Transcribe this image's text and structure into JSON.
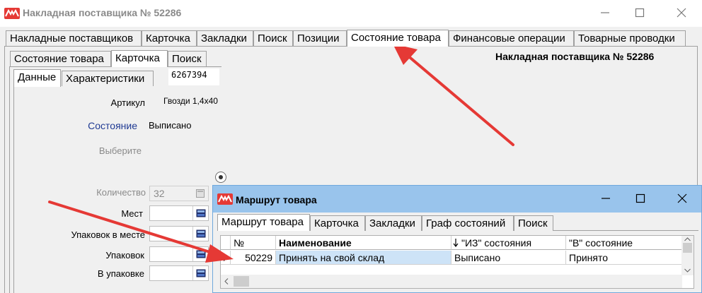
{
  "main_window": {
    "title": "Накладная поставщика № 52286",
    "tabs": [
      "Накладные поставщиков",
      "Карточка",
      "Закладки",
      "Поиск",
      "Позиции",
      "Состояние товара",
      "Финансовые операции",
      "Товарные проводки"
    ],
    "active_tab_index": 5,
    "sub_tabs": [
      "Состояние товара",
      "Карточка",
      "Поиск"
    ],
    "active_sub_tab_index": 1,
    "card_tabs": [
      "Данные",
      "Характеристики"
    ],
    "active_card_tab_index": 0,
    "doc_header": "Накладная поставщика № 52286",
    "code": "6267394",
    "fields": {
      "article_label": "Артикул",
      "article_value": "Гвозди 1,4х40",
      "state_label": "Состояние",
      "state_value": "Выписано",
      "choose_label": "Выберите",
      "quantity_label": "Количество",
      "quantity_value": "32",
      "places_label": "Мест",
      "packs_per_place_label": "Упаковок в месте",
      "packs_label": "Упаковок",
      "in_pack_label": "В упаковке"
    }
  },
  "popup": {
    "title": "Маршрут товара",
    "tabs": [
      "Маршрут товара",
      "Карточка",
      "Закладки",
      "Граф состояний",
      "Поиск"
    ],
    "active_tab_index": 0,
    "columns": [
      "№",
      "Наименование",
      "\"ИЗ\" состояния",
      "\"В\" состояние"
    ],
    "rows": [
      {
        "number": "50229",
        "name": "Принять на свой склад",
        "from_state": "Выписано",
        "to_state": "Принято"
      }
    ]
  },
  "colors": {
    "logo_red": "#e53935",
    "popup_title_bg": "#99c4ec",
    "state_label_blue": "#1f3a93",
    "annotation_arrow": "#e53935",
    "selected_cell": "#cde3f7"
  },
  "icons": [
    "app-logo-icon",
    "minimize-icon",
    "maximize-icon",
    "close-icon",
    "calculator-icon",
    "radio-selected-icon",
    "row-pointer-icon",
    "sort-down-arrow-icon",
    "annotation-arrow"
  ]
}
